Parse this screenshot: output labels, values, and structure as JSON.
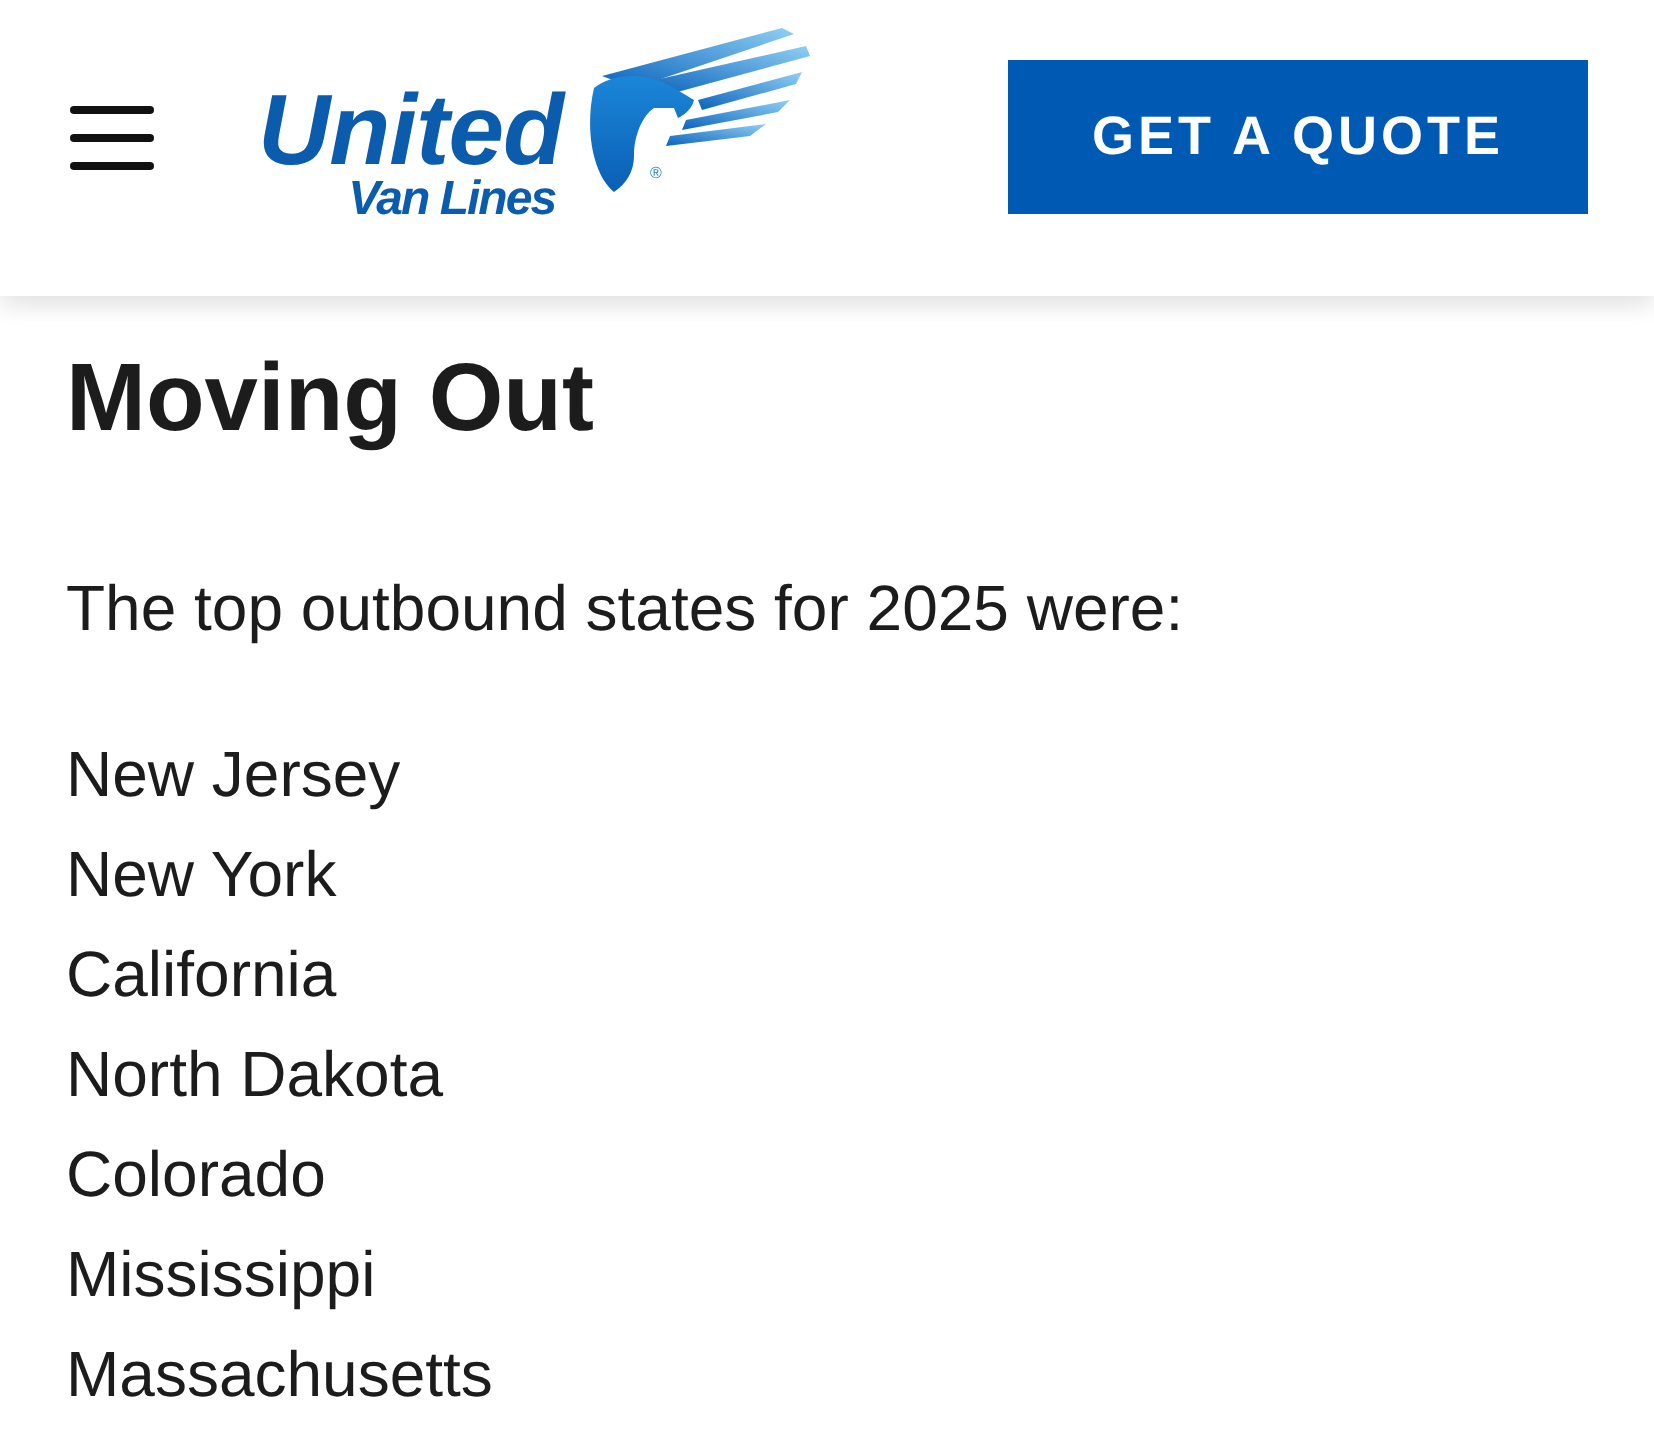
{
  "header": {
    "logo": {
      "wordmark": "United",
      "tagline": "Van Lines",
      "registered_mark": "®"
    },
    "quote_button": "GET A QUOTE"
  },
  "section": {
    "heading": "Moving Out",
    "intro": "The top outbound states for 2025 were:",
    "states": [
      "New Jersey",
      "New York",
      "California",
      "North Dakota",
      "Colorado",
      "Mississippi",
      "Massachusetts"
    ]
  }
}
